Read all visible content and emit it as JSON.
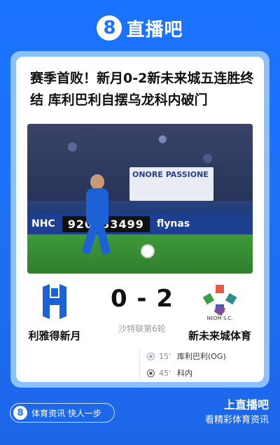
{
  "brand": {
    "logo_glyph": "8",
    "name": "直播吧"
  },
  "article": {
    "headline": "赛季首败！新月0-2新未来城五连胜终结 库利巴利自摆乌龙科内破门",
    "photo": {
      "banner_text": "ONORE PASSIONE",
      "ad_left": "NHC",
      "ad_number": "920033499",
      "ad_right": "flynas"
    }
  },
  "match": {
    "home_team": "利雅得新月",
    "away_team": "新未来城体育",
    "away_logo_text": "NEOM S.C.",
    "score": "0 - 2",
    "round": "沙特联第6轮",
    "events": [
      {
        "minute": "15'",
        "text": "库利巴利(OG)",
        "icon": "own-goal-icon"
      },
      {
        "minute": "45'",
        "text": "科内",
        "icon": "goal-icon"
      }
    ]
  },
  "footer": {
    "pill_logo": "8",
    "pill_text": "体育资讯 快人一步",
    "right_line1": "上直播吧",
    "right_line2": "看精彩体育资讯"
  },
  "colors": {
    "brand_blue": "#1a73ff",
    "home_blue": "#1c62d6"
  }
}
